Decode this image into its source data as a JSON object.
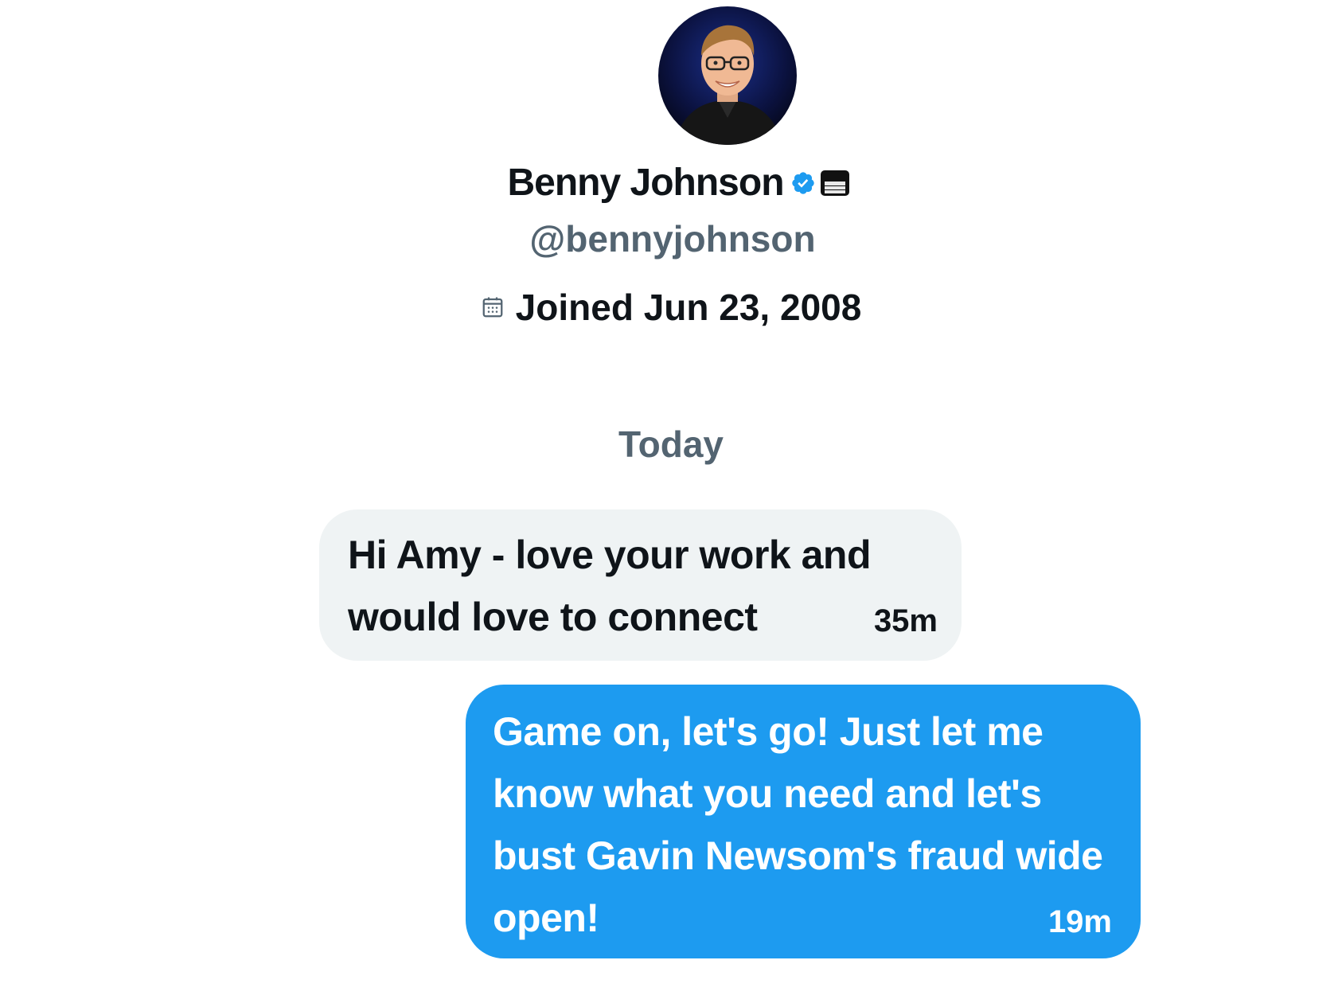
{
  "profile": {
    "display_name": "Benny Johnson",
    "handle": "@bennyjohnson",
    "joined": "Joined Jun 23, 2008",
    "verified": true,
    "icons": {
      "verified": "verified-badge-icon",
      "affiliate": "affiliate-badge-icon",
      "calendar": "calendar-icon"
    }
  },
  "conversation": {
    "date_divider": "Today",
    "messages": [
      {
        "direction": "received",
        "text": "Hi Amy - love your work and would love to connect",
        "time": "35m"
      },
      {
        "direction": "sent",
        "text": "Game on, let's go! Just let me know what you need and let's bust Gavin Newsom's fraud wide open!",
        "time": "19m"
      }
    ]
  },
  "colors": {
    "primary_text": "#0f1419",
    "secondary_text": "#536471",
    "sent_bubble": "#1d9bf0",
    "received_bubble": "#eff3f4",
    "verified": "#1d9bf0"
  }
}
